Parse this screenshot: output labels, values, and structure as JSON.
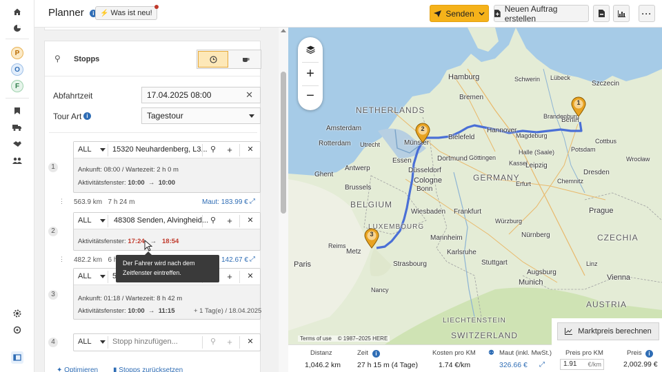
{
  "app": {
    "title": "Planner",
    "whats_new": "Was ist neu!",
    "send_label": "Senden",
    "new_order_label": "Neuen Auftrag erstellen"
  },
  "rail": {
    "badges": [
      "P",
      "O",
      "F"
    ],
    "icons": [
      "home-icon",
      "dashboard-icon",
      "bookmark-icon",
      "truck-icon",
      "handshake-icon",
      "users-icon",
      "gear-icon",
      "support-icon",
      "collapse-icon"
    ]
  },
  "stops_panel": {
    "title": "Stopps",
    "departure_label": "Abfahrtzeit",
    "departure_value": "17.04.2025 08:00",
    "tour_type_label": "Tour Art",
    "tour_type_value": "Tagestour",
    "stops": [
      {
        "number": "1",
        "filter": "ALL",
        "address": "15320 Neuhardenberg, L3...",
        "arrival": "Ankunft: 08:00 / Wartezeit: 2 h 0 m",
        "window_label": "Aktivitätsfenster:",
        "window_from": "10:00",
        "window_to": "10:00"
      },
      {
        "number": "2",
        "filter": "ALL",
        "address": "48308 Senden, Alvingheid...",
        "window_label": "Aktivitätsfenster:",
        "window_from": "17:24",
        "window_to": "18:54"
      },
      {
        "number": "3",
        "filter": "ALL",
        "address": "5",
        "arrival": "Ankunft: 01:18 / Wartezeit: 8 h 42 m",
        "window_label": "Aktivitätsfenster:",
        "window_from": "10:00",
        "window_to": "11:15",
        "extra": "+ 1 Tag(e) / 18.04.2025"
      },
      {
        "number": "4",
        "filter": "ALL",
        "placeholder": "Stopp hinzufügen..."
      }
    ],
    "legs": [
      {
        "distance": "563.9 km",
        "time": "7 h 24 m",
        "toll": "Maut: 183.99 €"
      },
      {
        "distance": "482.2 km",
        "time": "6 h 2",
        "toll": "142.67 €"
      }
    ],
    "tooltip": "Der Fahrer wird nach dem Zeitfenster eintreffen.",
    "optimize_label": "Optimieren",
    "reset_label": "Stopps zurücksetzen"
  },
  "map": {
    "labels": [
      "Hamburg",
      "Bremen",
      "Szczecin",
      "NETHERLANDS",
      "Amsterdam",
      "Berlin",
      "Münster",
      "Bielefeld",
      "Hannover",
      "Magdeburg",
      "Potsdam",
      "Brandenburg",
      "Rotterdam",
      "Utrecht",
      "Dortmund",
      "Essen",
      "Düsseldorf",
      "Kassel",
      "Leipzig",
      "Dresden",
      "Halle (Saale)",
      "Antwerp",
      "Ghent",
      "Brussels",
      "Cologne",
      "Bonn",
      "GERMANY",
      "Erfurt",
      "Chemnitz",
      "Wrocław",
      "BELGIUM",
      "Wiesbaden",
      "Frankfurt",
      "Prague",
      "LUXEMBOURG",
      "Mannheim",
      "Nürnberg",
      "Metz",
      "Karlsruhe",
      "Stuttgart",
      "CZECHIA",
      "Paris",
      "Strasbourg",
      "Augsburg",
      "Munich",
      "Linz",
      "Vienna",
      "AUSTRIA",
      "LIECHTENSTEIN",
      "SWITZERLAND",
      "Lübeck",
      "Schwerin",
      "Cottbus",
      "Göttingen",
      "Würzburg",
      "Nancy",
      "Reims"
    ],
    "markers": [
      "1",
      "2",
      "3"
    ],
    "terms": "Terms of use",
    "copyright": "© 1987–2025 HERE"
  },
  "market": {
    "button_label": "Marktpreis berechnen",
    "price_per_km_label": "Preis pro KM",
    "price_per_km_value": "1.91",
    "price_per_km_unit": "€/km",
    "price_label": "Preis",
    "price_value": "2,002.99 €"
  },
  "summary": {
    "distance_label": "Distanz",
    "distance_value": "1,046.2 km",
    "time_label": "Zeit",
    "time_value": "27 h 15 m (4 Tage)",
    "cost_label": "Kosten pro KM",
    "cost_value": "1.74 €/km",
    "toll_label": "Maut (inkl. MwSt.)",
    "toll_value": "326.66 €"
  },
  "colors": {
    "accent": "#f5b21a",
    "route": "#4a6fd6",
    "link": "#2f6db5",
    "late": "#c0392b"
  }
}
